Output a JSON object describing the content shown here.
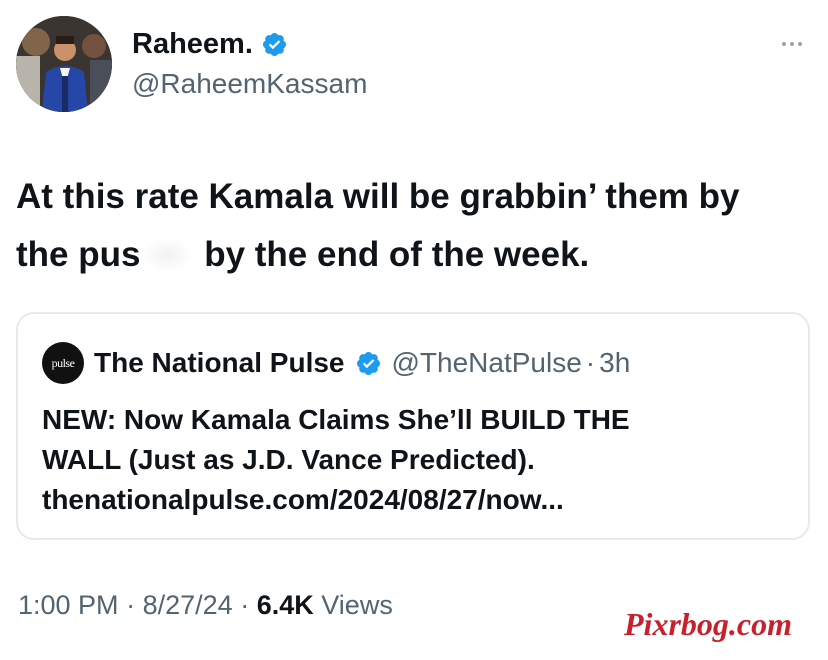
{
  "author": {
    "display_name": "Raheem.",
    "handle": "@RaheemKassam",
    "verified_icon": "verified-badge",
    "verified_color": "#1d9bf0"
  },
  "more_icon": "more-horizontal-icon",
  "tweet": {
    "line_1": "At this rate Kamala will be grabbin’ them by",
    "line_2_start": "the pus",
    "line_2_end": "by the end of the week."
  },
  "quote": {
    "avatar_text": "pulse",
    "name": "The National Pulse",
    "handle": "@TheNatPulse",
    "separator": "·",
    "time": "3h",
    "text_line_1": "NEW: Now Kamala Claims She’ll BUILD THE",
    "text_line_2": "WALL (Just as J.D. Vance Predicted).",
    "text_line_3": "thenationalpulse.com/2024/08/27/now..."
  },
  "meta": {
    "time": "1:00 PM",
    "separator": "·",
    "date": "8/27/24",
    "views_count": "6.4K",
    "views_label": "Views"
  },
  "watermark": "Pixrbog.com"
}
